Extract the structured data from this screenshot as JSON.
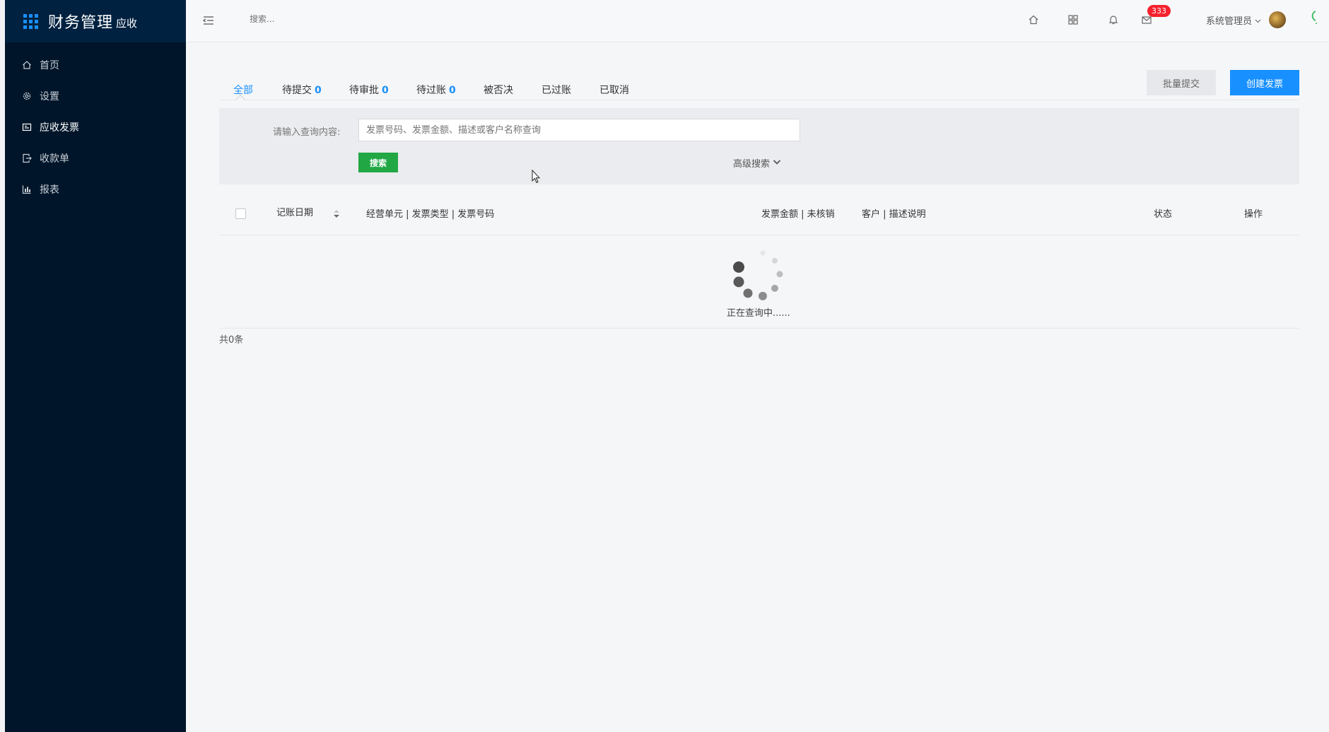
{
  "sidebar": {
    "title": "财务管理",
    "subtitle": "应收",
    "items": [
      {
        "label": "首页",
        "icon": "home-icon"
      },
      {
        "label": "设置",
        "icon": "gear-icon"
      },
      {
        "label": "应收发票",
        "icon": "invoice-icon",
        "active": true
      },
      {
        "label": "收款单",
        "icon": "receipt-icon"
      },
      {
        "label": "报表",
        "icon": "bar-chart-icon"
      }
    ]
  },
  "header": {
    "search_placeholder": "搜索...",
    "message_count": "333",
    "user_name": "系统管理员",
    "icons": [
      "menu-collapse-icon",
      "home-icon",
      "grid-apps-icon",
      "bell-icon",
      "mail-icon",
      "loading-spinner-icon"
    ]
  },
  "tabs": [
    {
      "label": "全部",
      "active": true
    },
    {
      "label": "待提交",
      "count": "0"
    },
    {
      "label": "待审批",
      "count": "0"
    },
    {
      "label": "待过账",
      "count": "0"
    },
    {
      "label": "被否决"
    },
    {
      "label": "已过账"
    },
    {
      "label": "已取消"
    }
  ],
  "actions": {
    "batch_submit": "批量提交",
    "create_invoice": "创建发票"
  },
  "search": {
    "label": "请输入查询内容:",
    "placeholder": "发票号码、发票金额、描述或客户名称查询",
    "button": "搜索",
    "advanced": "高级搜索"
  },
  "table": {
    "columns": {
      "date": "记账日期",
      "unit": "经营单元 | 发票类型 | 发票号码",
      "amount": "发票金额 | 未核销",
      "customer": "客户 | 描述说明",
      "status": "状态",
      "action": "操作"
    },
    "loading_text": "正在查询中......",
    "total": "共0条"
  },
  "colors": {
    "sidebar_bg": "#001529",
    "primary": "#1890ff",
    "success": "#22a745",
    "badge": "#f5222d"
  }
}
